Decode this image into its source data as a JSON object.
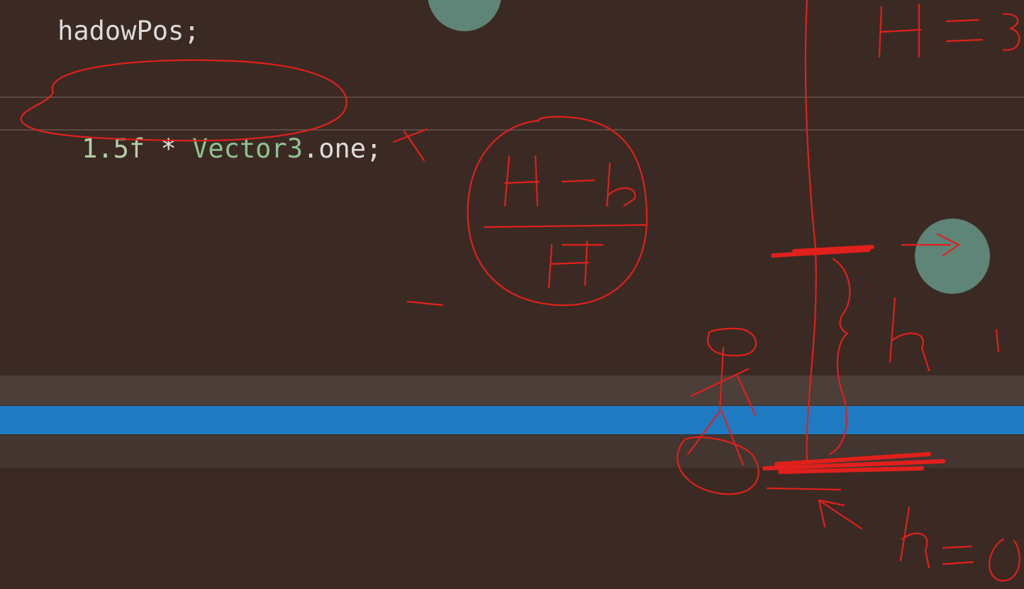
{
  "editor": {
    "line_top_text": "hadowPos;",
    "current_line": {
      "number_token": "1.5f",
      "operator_token": " * ",
      "type_token": "Vector3",
      "tail_token": ".one;"
    }
  },
  "colors": {
    "background": "#3b2a23",
    "selection_band": "#1f7bc1",
    "number_literal": "#b5cea8",
    "type_name": "#8fc28f",
    "ink": "#e0201c",
    "cursor_dot": "#5f8478"
  },
  "annotations": {
    "description": "red handwritten pen strokes over the editor",
    "icons": [
      "cursor-dot-icon"
    ]
  }
}
